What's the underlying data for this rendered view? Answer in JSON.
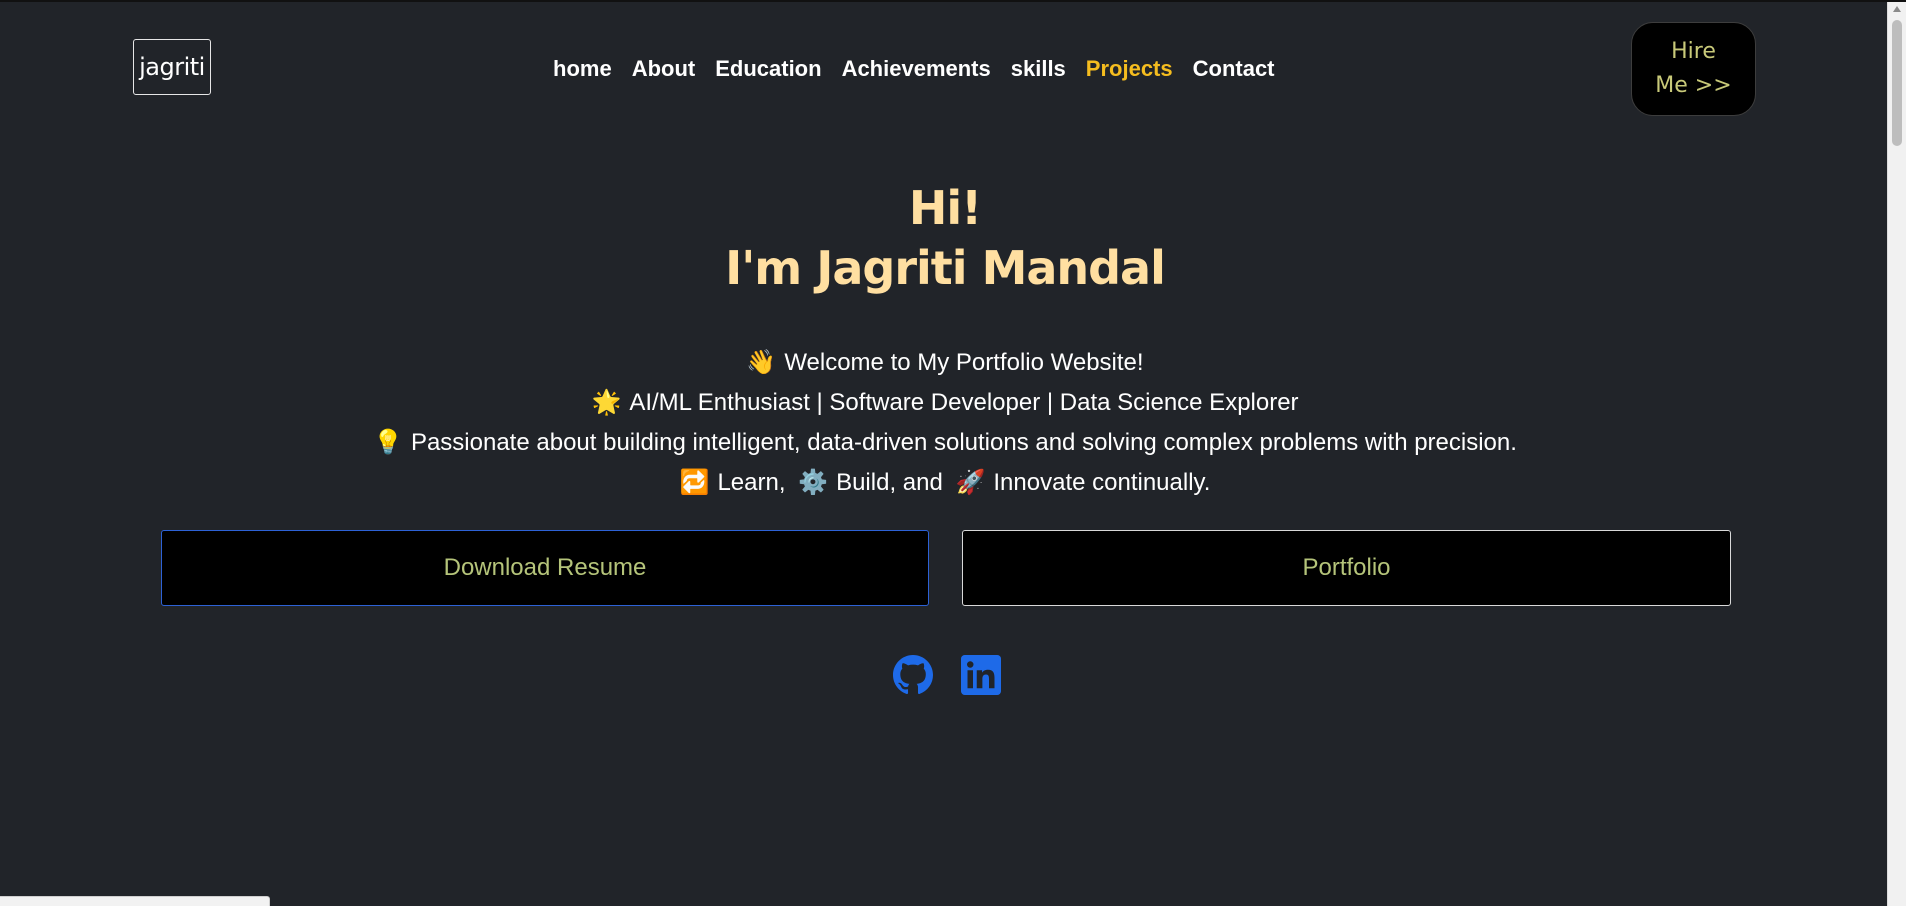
{
  "header": {
    "logo_text": "jagriti",
    "nav": [
      {
        "label": "home",
        "active": false
      },
      {
        "label": "About",
        "active": false
      },
      {
        "label": "Education",
        "active": false
      },
      {
        "label": "Achievements",
        "active": false
      },
      {
        "label": "skills",
        "active": false
      },
      {
        "label": "Projects",
        "active": true
      },
      {
        "label": "Contact",
        "active": false
      }
    ],
    "hire_line1": "Hire",
    "hire_line2": "Me >>"
  },
  "hero": {
    "greeting": "Hi!",
    "name_line": "I'm Jagriti Mandal",
    "intro": [
      {
        "emoji": "👋",
        "text": "Welcome to My Portfolio Website!"
      },
      {
        "emoji": "🌟",
        "text": "AI/ML Enthusiast | Software Developer | Data Science Explorer"
      },
      {
        "emoji": "💡",
        "text": "Passionate about building intelligent, data-driven solutions and solving complex problems with precision."
      }
    ],
    "learn_line": {
      "emoji1": "🔁",
      "text1": "Learn,",
      "emoji2": "⚙️",
      "text2": "Build, and",
      "emoji3": "🚀",
      "text3": "Innovate continually."
    }
  },
  "actions": {
    "resume_label": "Download Resume",
    "portfolio_label": "Portfolio"
  },
  "socials": [
    {
      "icon": "github-icon"
    },
    {
      "icon": "linkedin-icon"
    }
  ],
  "colors": {
    "background": "#212429",
    "accent_heading": "#ffdfa1",
    "nav_active": "#f5bd1f",
    "button_text": "#b5c47a",
    "icon_blue": "#1e6ae8"
  }
}
